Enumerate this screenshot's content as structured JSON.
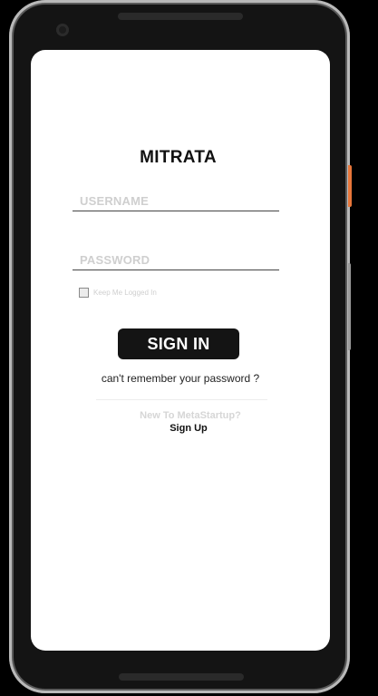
{
  "app": {
    "title": "MITRATA"
  },
  "login_form": {
    "username_placeholder": "USERNAME",
    "password_placeholder": "PASSWORD",
    "keep_logged_in_label": "Keep Me Logged In",
    "keep_logged_in_checked": false,
    "sign_in_label": "SIGN IN",
    "forgot_password_label": "can't remember your password ?"
  },
  "signup": {
    "prompt": "New To MetaStartup?",
    "link_label": "Sign Up"
  },
  "colors": {
    "background": "#000000",
    "device_frame": "#141414",
    "device_bezel_edge": "#b9b9b9",
    "side_button_accent": "#e8763a",
    "screen_background": "#ffffff",
    "primary_button": "#141414",
    "primary_button_text": "#ffffff",
    "placeholder_text": "#cfcfcf"
  }
}
